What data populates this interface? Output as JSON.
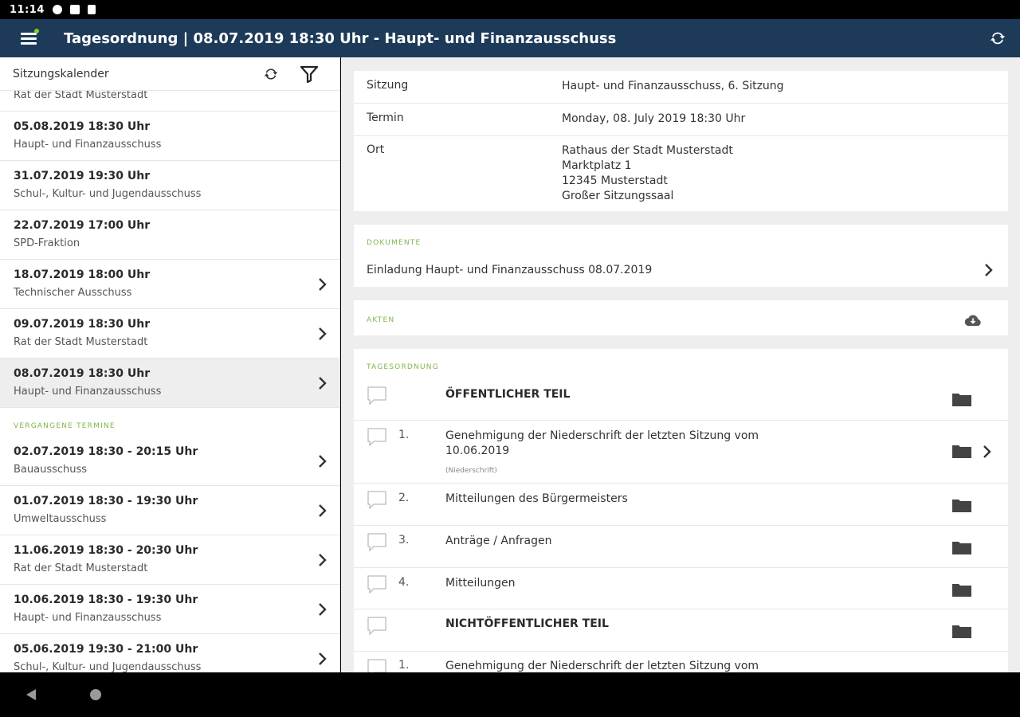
{
  "status_bar": {
    "time": "11:14"
  },
  "app_bar": {
    "title": "Tagesordnung | 08.07.2019 18:30 Uhr - Haupt- und Finanzausschuss"
  },
  "sidebar": {
    "header_title": "Sitzungskalender",
    "partial_item_subtitle": "Rat der Stadt Musterstadt",
    "upcoming": [
      {
        "date": "05.08.2019 18:30 Uhr",
        "subtitle": "Haupt- und Finanzausschuss"
      },
      {
        "date": "31.07.2019 19:30 Uhr",
        "subtitle": "Schul-, Kultur- und Jugendausschuss"
      },
      {
        "date": "22.07.2019 17:00 Uhr",
        "subtitle": "SPD-Fraktion"
      },
      {
        "date": "18.07.2019 18:00 Uhr",
        "subtitle": "Technischer Ausschuss"
      },
      {
        "date": "09.07.2019 18:30 Uhr",
        "subtitle": "Rat der Stadt Musterstadt"
      },
      {
        "date": "08.07.2019 18:30 Uhr",
        "subtitle": "Haupt- und Finanzausschuss"
      }
    ],
    "past_label": "VERGANGENE TERMINE",
    "past": [
      {
        "date": "02.07.2019 18:30 - 20:15 Uhr",
        "subtitle": "Bauausschuss"
      },
      {
        "date": "01.07.2019 18:30 - 19:30 Uhr",
        "subtitle": "Umweltausschuss"
      },
      {
        "date": "11.06.2019 18:30 - 20:30 Uhr",
        "subtitle": "Rat der Stadt Musterstadt"
      },
      {
        "date": "10.06.2019 18:30 - 19:30 Uhr",
        "subtitle": "Haupt- und Finanzausschuss"
      },
      {
        "date": "05.06.2019 19:30 - 21:00 Uhr",
        "subtitle": "Schul-, Kultur- und Jugendausschuss"
      }
    ]
  },
  "details": {
    "sitzung_label": "Sitzung",
    "sitzung_value": "Haupt- und Finanzausschuss, 6. Sitzung",
    "termin_label": "Termin",
    "termin_value": "Monday, 08. July 2019 18:30 Uhr",
    "ort_label": "Ort",
    "ort_lines": [
      "Rathaus der Stadt Musterstadt",
      "Marktplatz 1",
      "12345 Musterstadt",
      "Großer Sitzungssaal"
    ]
  },
  "dokumente": {
    "label": "DOKUMENTE",
    "item": "Einladung Haupt- und Finanzausschuss 08.07.2019"
  },
  "akten": {
    "label": "AKTEN"
  },
  "tagesordnung": {
    "label": "TAGESORDNUNG",
    "items": [
      {
        "num": "",
        "text": "ÖFFENTLICHER TEIL",
        "sub": ""
      },
      {
        "num": "1.",
        "text": "Genehmigung der Niederschrift der letzten Sitzung vom 10.06.2019",
        "sub": "(Niederschrift)"
      },
      {
        "num": "2.",
        "text": "Mitteilungen des Bürgermeisters",
        "sub": ""
      },
      {
        "num": "3.",
        "text": "Anträge / Anfragen",
        "sub": ""
      },
      {
        "num": "4.",
        "text": "Mitteilungen",
        "sub": ""
      },
      {
        "num": "",
        "text": "NICHTÖFFENTLICHER TEIL",
        "sub": ""
      },
      {
        "num": "1.",
        "text": "Genehmigung der Niederschrift der letzten Sitzung vom",
        "sub": ""
      }
    ]
  },
  "colors": {
    "app_bar": "#1d3b59",
    "accent_green": "#7cb84a",
    "background": "#eeeeee"
  }
}
